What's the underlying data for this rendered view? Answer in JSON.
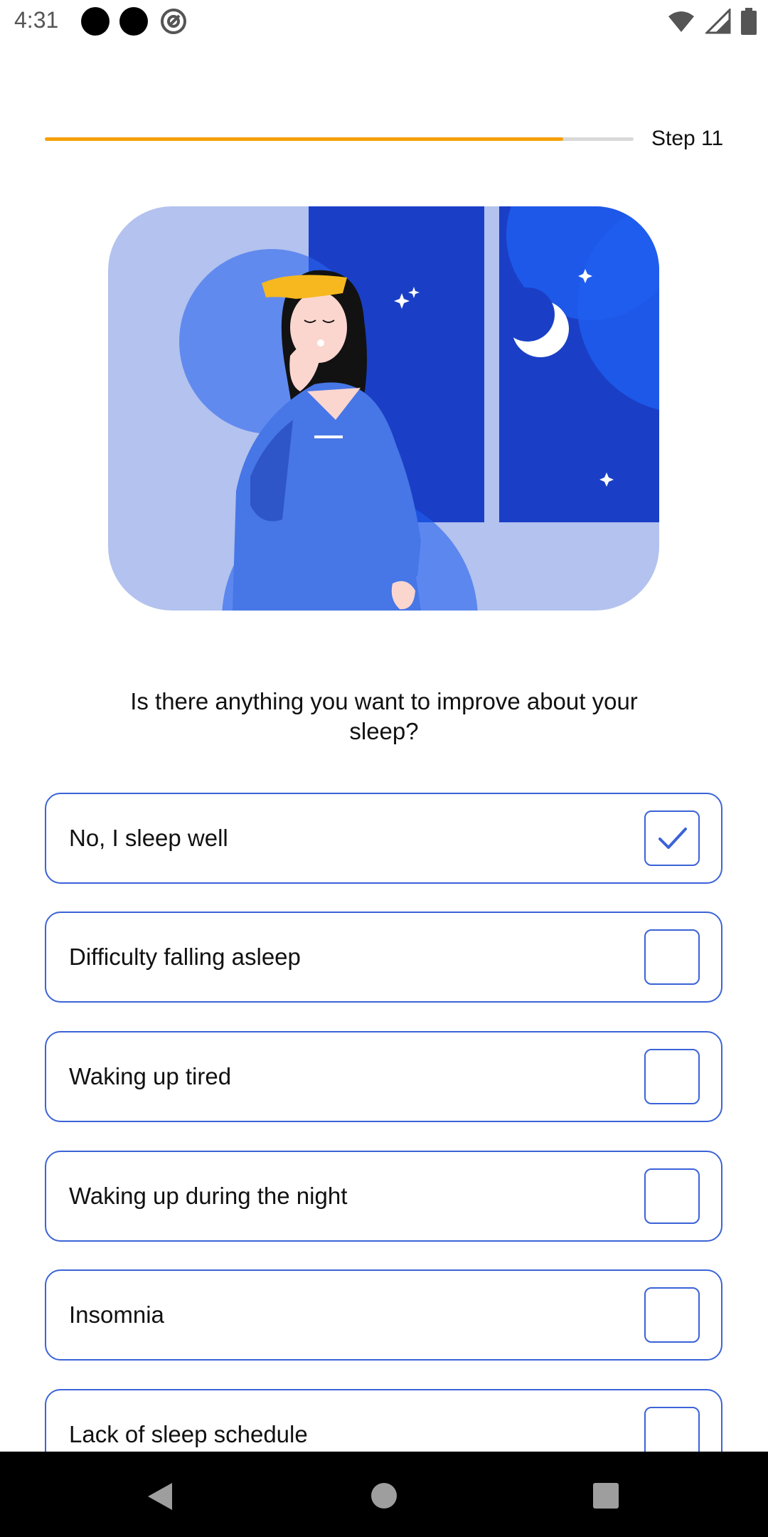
{
  "status_bar": {
    "time": "4:31"
  },
  "progress": {
    "step_label": "Step 11",
    "fraction": 0.88
  },
  "question": "Is there anything you want to improve about your sleep?",
  "options": [
    {
      "label": "No, I sleep well",
      "checked": true
    },
    {
      "label": "Difficulty falling asleep",
      "checked": false
    },
    {
      "label": "Waking up tired",
      "checked": false
    },
    {
      "label": "Waking up during the night",
      "checked": false
    },
    {
      "label": "Insomnia",
      "checked": false
    },
    {
      "label": "Lack of sleep schedule",
      "checked": false
    }
  ],
  "colors": {
    "accent": "#3b63d8",
    "progress": "#f5a10a"
  }
}
